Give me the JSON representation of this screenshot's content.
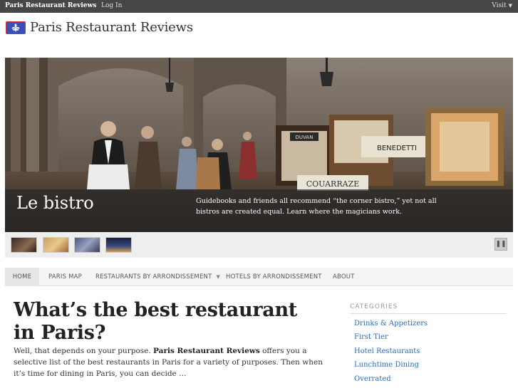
{
  "topbar": {
    "site_name": "Paris Restaurant Reviews",
    "login": "Log In",
    "visit": "Visit"
  },
  "header": {
    "site_title": "Paris Restaurant Reviews"
  },
  "slider": {
    "title": "Le bistro",
    "text": "Guidebooks and friends all recommend “the corner bistro,” yet not all bistros are created equal. Learn where the magicians work.",
    "sign_benedetti": "BENEDETTI",
    "sign_couarraze": "COUARRAZE",
    "sign_duvan": "DUVAN",
    "pause_label": "❚❚"
  },
  "nav": {
    "items": [
      {
        "label": "HOME"
      },
      {
        "label": "PARIS MAP"
      },
      {
        "label": "RESTAURANTS BY ARRONDISSEMENT"
      },
      {
        "label": "HOTELS BY ARRONDISSEMENT"
      },
      {
        "label": "ABOUT"
      }
    ]
  },
  "main": {
    "title": "What’s the best restaurant in Paris?",
    "body_prefix": "Well, that depends on your purpose. ",
    "body_bold": "Paris Restaurant Reviews",
    "body_suffix": " offers you a selective list of the best restaurants in Paris for a variety of purposes. Then when it’s time for dining in Paris, you can decide …"
  },
  "sidebar": {
    "heading": "CATEGORIES",
    "categories": [
      {
        "label": "Drinks & Appetizers"
      },
      {
        "label": "First Tier"
      },
      {
        "label": "Hotel Restaurants"
      },
      {
        "label": "Lunchtime Dining"
      },
      {
        "label": "Overrated"
      }
    ]
  },
  "colors": {
    "topbar_bg": "#464646",
    "link": "#2a6db5",
    "logo_blue": "#3b4fb4"
  }
}
